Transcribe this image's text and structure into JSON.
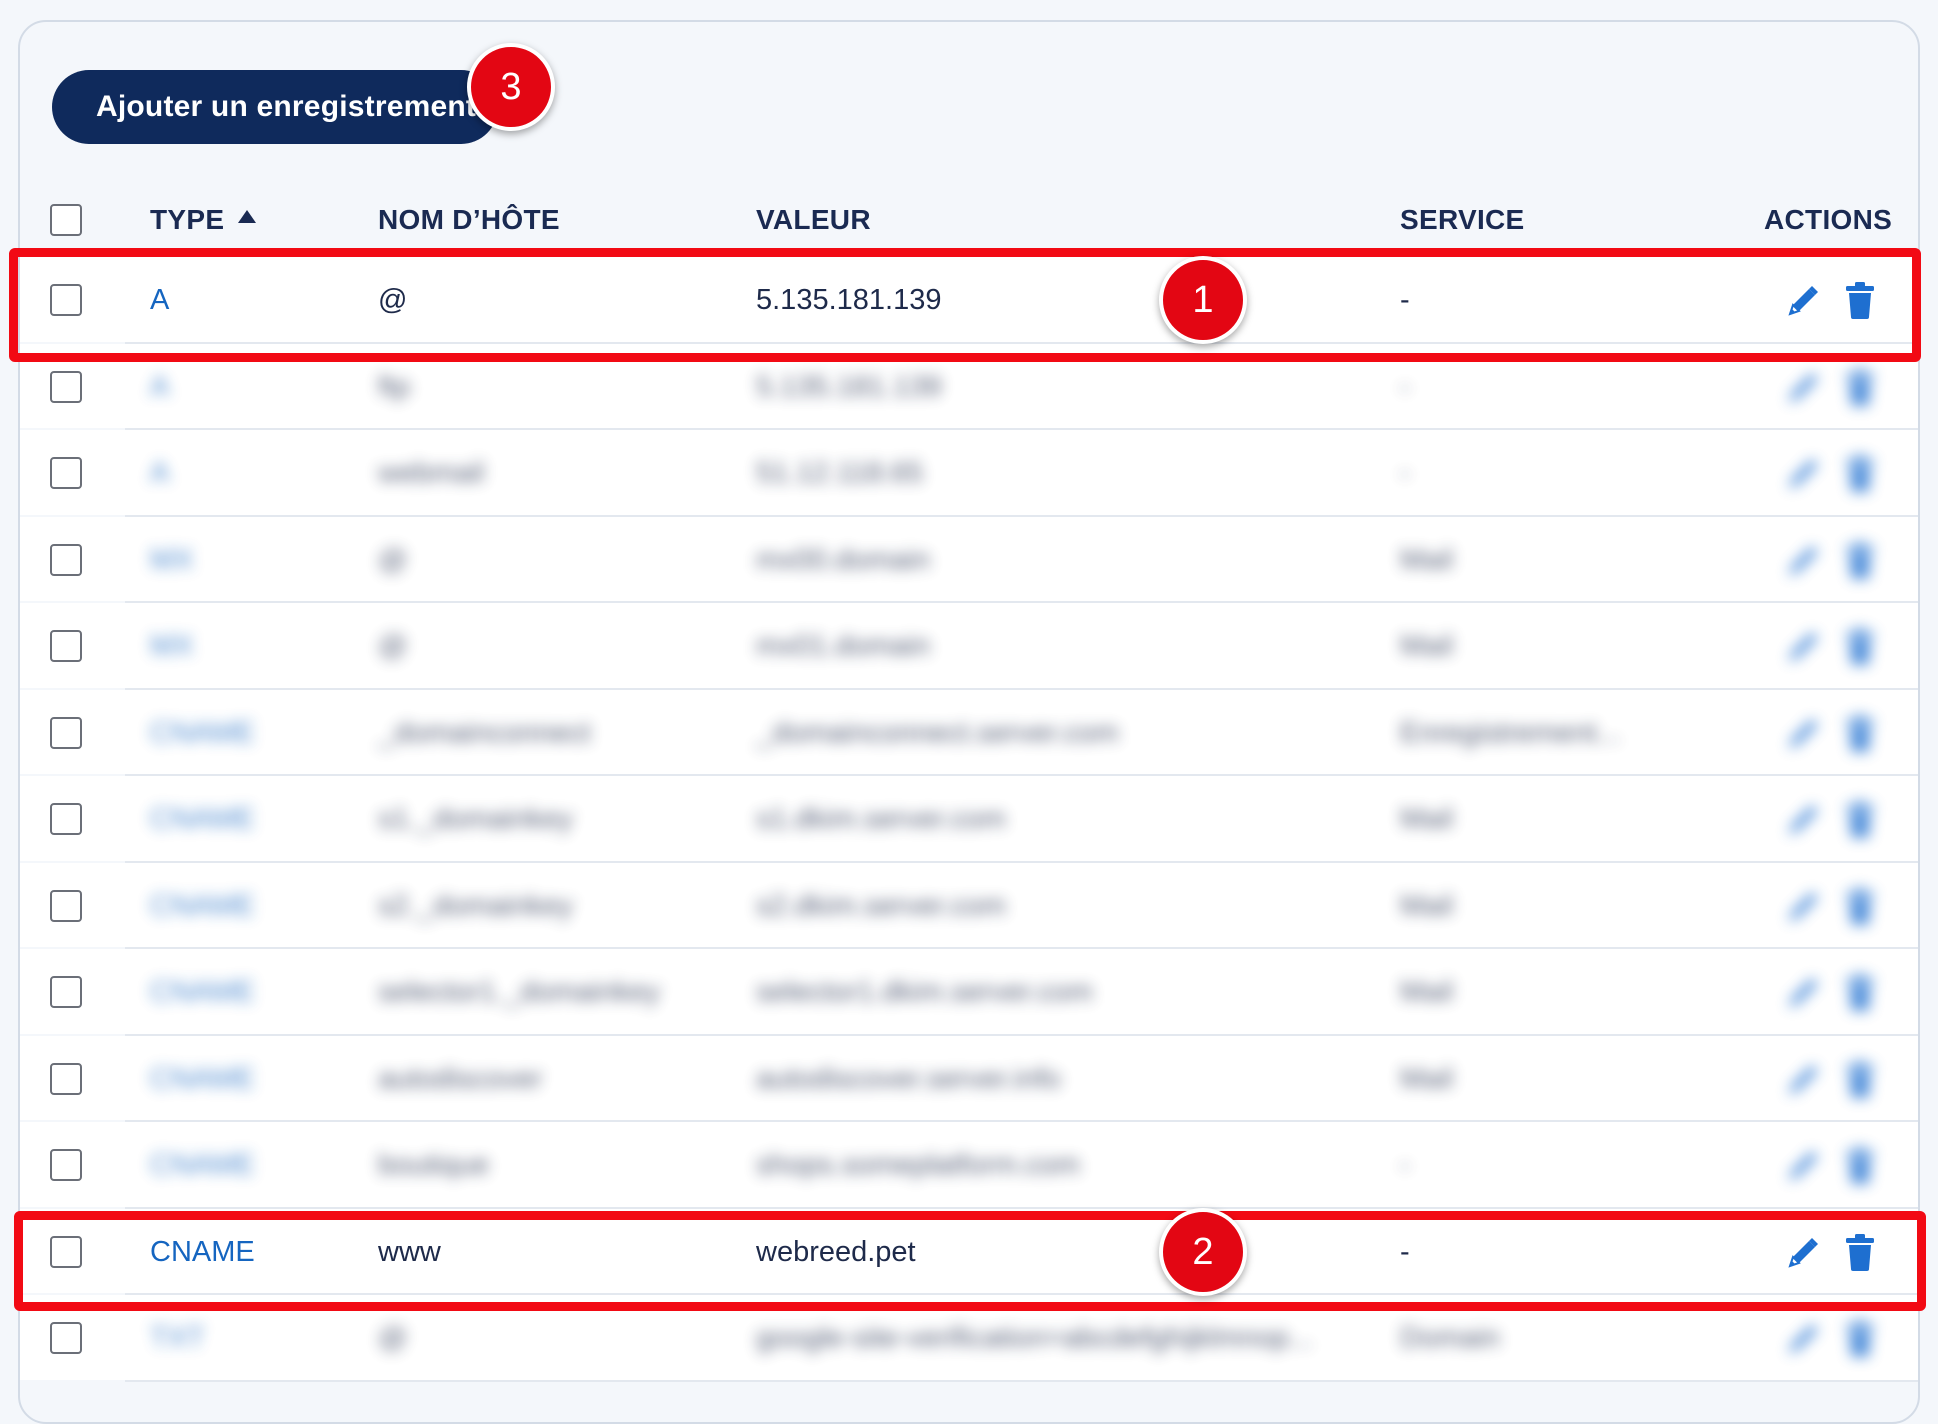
{
  "toolbar": {
    "add_label": "Ajouter un enregistrement"
  },
  "badges": {
    "one": "1",
    "two": "2",
    "three": "3"
  },
  "columns": {
    "type": "TYPE",
    "host": "NOM D’HÔTE",
    "value": "VALEUR",
    "service": "SERVICE",
    "actions": "ACTIONS"
  },
  "rows": [
    {
      "type": "A",
      "host": "@",
      "value": "5.135.181.139",
      "service": "-",
      "blurred": false
    },
    {
      "type": "A",
      "host": "ftp",
      "value": "5.135.181.139",
      "service": "-",
      "blurred": true
    },
    {
      "type": "A",
      "host": "webmail",
      "value": "51.12.118.65",
      "service": "-",
      "blurred": true
    },
    {
      "type": "MX",
      "host": "@",
      "value": "mx00.domain",
      "service": "Mail",
      "blurred": true
    },
    {
      "type": "MX",
      "host": "@",
      "value": "mx01.domain",
      "service": "Mail",
      "blurred": true
    },
    {
      "type": "CNAME",
      "host": "_domainconnect",
      "value": "_domainconnect.server.com",
      "service": "Enregistrement...",
      "blurred": true
    },
    {
      "type": "CNAME",
      "host": "s1._domainkey",
      "value": "s1.dkim.server.com",
      "service": "Mail",
      "blurred": true
    },
    {
      "type": "CNAME",
      "host": "s2._domainkey",
      "value": "s2.dkim.server.com",
      "service": "Mail",
      "blurred": true
    },
    {
      "type": "CNAME",
      "host": "selector1._domainkey",
      "value": "selector1.dkim.server.com",
      "service": "Mail",
      "blurred": true
    },
    {
      "type": "CNAME",
      "host": "autodiscover",
      "value": "autodiscover.server.info",
      "service": "Mail",
      "blurred": true
    },
    {
      "type": "CNAME",
      "host": "boutique",
      "value": "shops.someplatform.com",
      "service": "-",
      "blurred": true
    },
    {
      "type": "CNAME",
      "host": "www",
      "value": "webreed.pet",
      "service": "-",
      "blurred": false
    },
    {
      "type": "TXT",
      "host": "@",
      "value": "google-site-verification=abcdefghijklmnop...",
      "service": "Domain",
      "blurred": true
    }
  ],
  "colors": {
    "primary": "#0f2a5c",
    "link": "#1565c0",
    "highlight": "#f20a14",
    "badge": "#e30613"
  }
}
